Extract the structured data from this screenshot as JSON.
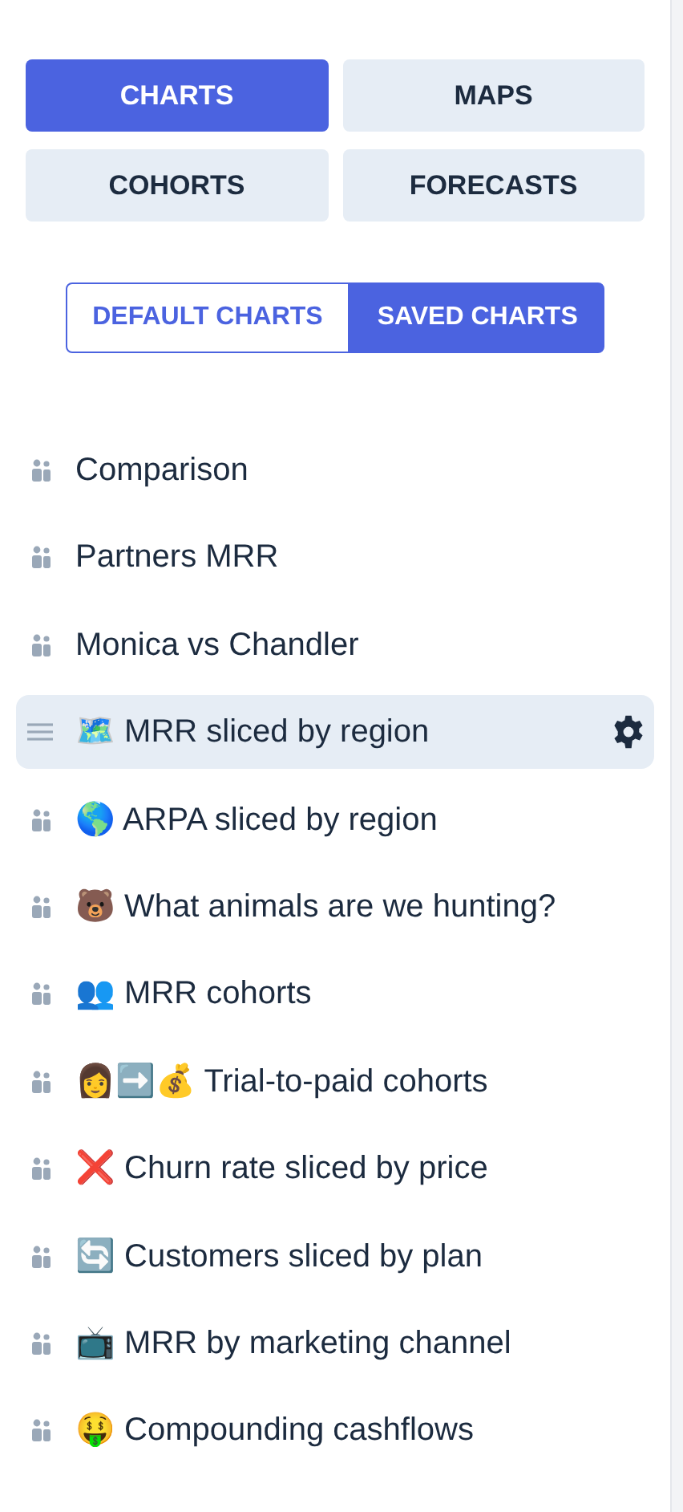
{
  "categories": [
    {
      "label": "CHARTS",
      "selected": true
    },
    {
      "label": "MAPS",
      "selected": false
    },
    {
      "label": "COHORTS",
      "selected": false
    },
    {
      "label": "FORECASTS",
      "selected": false
    }
  ],
  "chart_sets": [
    {
      "label": "DEFAULT CHARTS",
      "selected": false
    },
    {
      "label": "SAVED CHARTS",
      "selected": true
    }
  ],
  "charts": [
    {
      "label": "Comparison",
      "selected": false
    },
    {
      "label": "Partners MRR",
      "selected": false
    },
    {
      "label": "Monica vs Chandler",
      "selected": false
    },
    {
      "label": "🗺️ MRR sliced by region",
      "selected": true
    },
    {
      "label": "🌎 ARPA sliced by region",
      "selected": false
    },
    {
      "label": "🐻 What animals are we hunting?",
      "selected": false
    },
    {
      "label": "👥 MRR cohorts",
      "selected": false
    },
    {
      "label": "👩➡️💰 Trial-to-paid cohorts",
      "selected": false
    },
    {
      "label": "❌ Churn rate sliced by price",
      "selected": false
    },
    {
      "label": "🔄 Customers sliced by plan",
      "selected": false
    },
    {
      "label": "📺 MRR by marketing channel",
      "selected": false
    },
    {
      "label": "🤑 Compounding cashflows",
      "selected": false
    }
  ]
}
